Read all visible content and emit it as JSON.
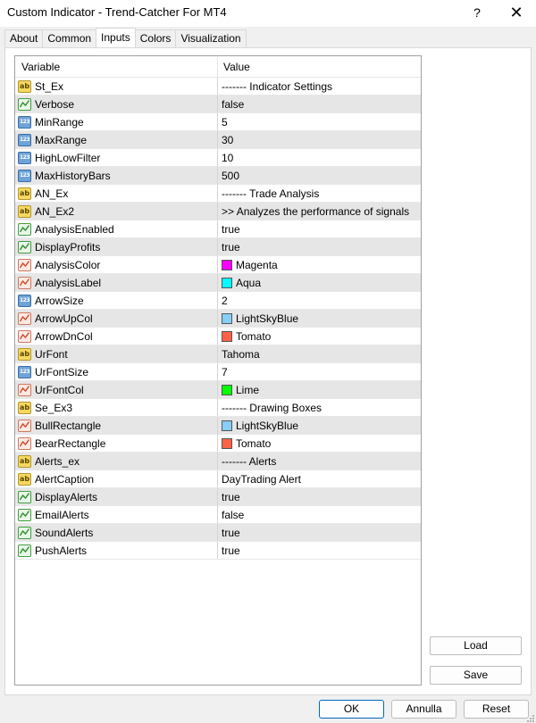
{
  "window": {
    "title": "Custom Indicator - Trend-Catcher For MT4",
    "help_glyph": "?",
    "close_glyph": "✕"
  },
  "tabs": [
    {
      "label": "About",
      "active": false
    },
    {
      "label": "Common",
      "active": false
    },
    {
      "label": "Inputs",
      "active": true
    },
    {
      "label": "Colors",
      "active": false
    },
    {
      "label": "Visualization",
      "active": false
    }
  ],
  "grid": {
    "headers": {
      "variable": "Variable",
      "value": "Value"
    },
    "rows": [
      {
        "name": "St_Ex",
        "type": "string",
        "value": "------- Indicator Settings"
      },
      {
        "name": "Verbose",
        "type": "bool",
        "value": "false"
      },
      {
        "name": "MinRange",
        "type": "int",
        "value": "5"
      },
      {
        "name": "MaxRange",
        "type": "int",
        "value": "30"
      },
      {
        "name": "HighLowFilter",
        "type": "int",
        "value": "10"
      },
      {
        "name": "MaxHistoryBars",
        "type": "int",
        "value": "500"
      },
      {
        "name": "AN_Ex",
        "type": "string",
        "value": "------- Trade Analysis"
      },
      {
        "name": "AN_Ex2",
        "type": "string",
        "value": ">> Analyzes the performance of signals"
      },
      {
        "name": "AnalysisEnabled",
        "type": "bool",
        "value": "true"
      },
      {
        "name": "DisplayProfits",
        "type": "bool",
        "value": "true"
      },
      {
        "name": "AnalysisColor",
        "type": "color",
        "value": "Magenta",
        "swatch": "#ff00ff"
      },
      {
        "name": "AnalysisLabel",
        "type": "color",
        "value": "Aqua",
        "swatch": "#00ffff"
      },
      {
        "name": "ArrowSize",
        "type": "int",
        "value": "2"
      },
      {
        "name": "ArrowUpCol",
        "type": "color",
        "value": "LightSkyBlue",
        "swatch": "#87cefa"
      },
      {
        "name": "ArrowDnCol",
        "type": "color",
        "value": "Tomato",
        "swatch": "#ff6347"
      },
      {
        "name": "UrFont",
        "type": "string",
        "value": "Tahoma"
      },
      {
        "name": "UrFontSize",
        "type": "int",
        "value": "7"
      },
      {
        "name": "UrFontCol",
        "type": "color",
        "value": "Lime",
        "swatch": "#00ff00"
      },
      {
        "name": "Se_Ex3",
        "type": "string",
        "value": "------- Drawing Boxes"
      },
      {
        "name": "BullRectangle",
        "type": "color",
        "value": "LightSkyBlue",
        "swatch": "#87cefa"
      },
      {
        "name": "BearRectangle",
        "type": "color",
        "value": "Tomato",
        "swatch": "#ff6347"
      },
      {
        "name": "Alerts_ex",
        "type": "string",
        "value": "------- Alerts"
      },
      {
        "name": "AlertCaption",
        "type": "string",
        "value": "DayTrading Alert"
      },
      {
        "name": "DisplayAlerts",
        "type": "bool",
        "value": "true"
      },
      {
        "name": "EmailAlerts",
        "type": "bool",
        "value": "false"
      },
      {
        "name": "SoundAlerts",
        "type": "bool",
        "value": "true"
      },
      {
        "name": "PushAlerts",
        "type": "bool",
        "value": "true"
      }
    ]
  },
  "side_buttons": {
    "load": "Load",
    "save": "Save"
  },
  "footer_buttons": {
    "ok": "OK",
    "cancel": "Annulla",
    "reset": "Reset"
  },
  "type_icons": {
    "string": "ab",
    "int": "123"
  }
}
